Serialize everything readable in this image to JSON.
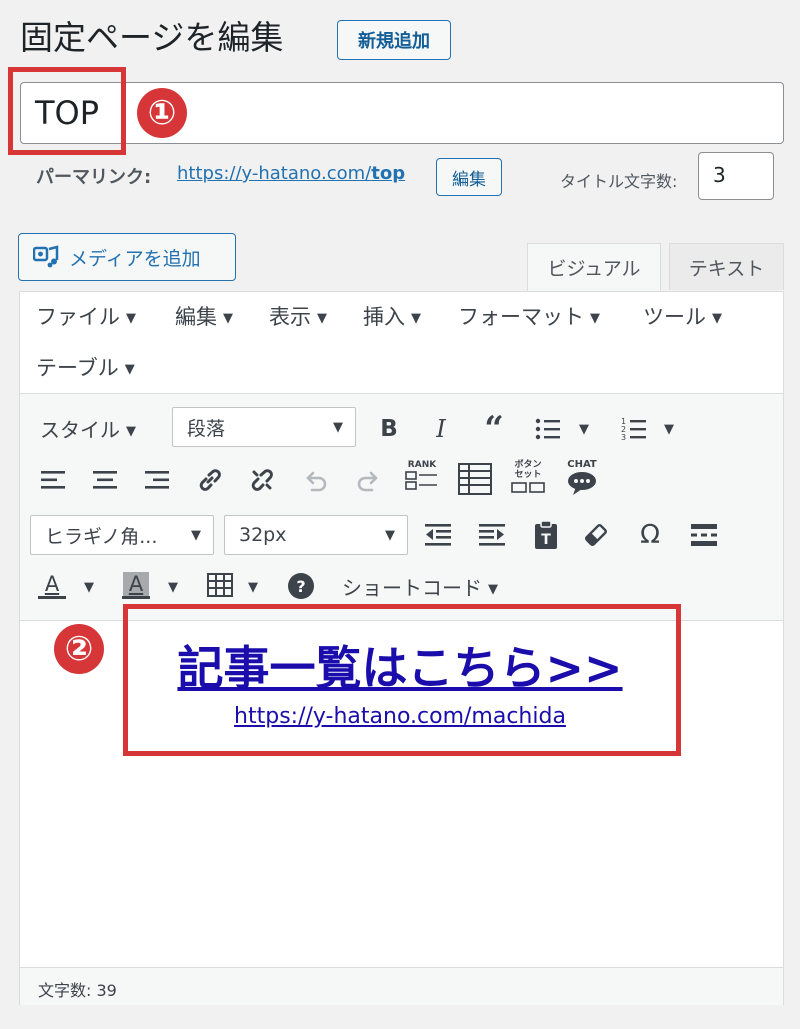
{
  "header": {
    "title": "固定ページを編集",
    "add_new": "新規追加"
  },
  "title_field": {
    "value": "TOP"
  },
  "annotations": {
    "marker1": "①",
    "marker2": "②",
    "color": "#d63638"
  },
  "permalink": {
    "label": "パーマリンク:",
    "url_prefix": "https://y-hatano.com/",
    "slug": "top",
    "edit_button": "編集"
  },
  "title_count": {
    "label": "タイトル文字数:",
    "value": "3"
  },
  "media_button": {
    "label": "メディアを追加"
  },
  "tabs": {
    "visual": "ビジュアル",
    "text": "テキスト"
  },
  "menubar": {
    "items": [
      "ファイル",
      "編集",
      "表示",
      "挿入",
      "フォーマット",
      "ツール",
      "テーブル"
    ],
    "caret": "▼"
  },
  "toolbar": {
    "style_label": "スタイル",
    "format_select": "段落",
    "font_family_select": "ヒラギノ角...",
    "font_size_select": "32px",
    "rank_label": "RANK",
    "button_set_label_1": "ボタン",
    "button_set_label_2": "セット",
    "chat_label": "CHAT",
    "shortcode_label": "ショートコード",
    "omega": "Ω",
    "help": "?",
    "text_color_letter": "A",
    "bg_color_letter": "A"
  },
  "content": {
    "link_title": "記事一覧はこちら>>",
    "link_url": "https://y-hatano.com/machida"
  },
  "status_bar": {
    "word_count": "文字数: 39"
  },
  "colors": {
    "accent": "#2271b1",
    "link": "#1a0dab",
    "annotation": "#d63638",
    "background": "#f1f1f1"
  }
}
